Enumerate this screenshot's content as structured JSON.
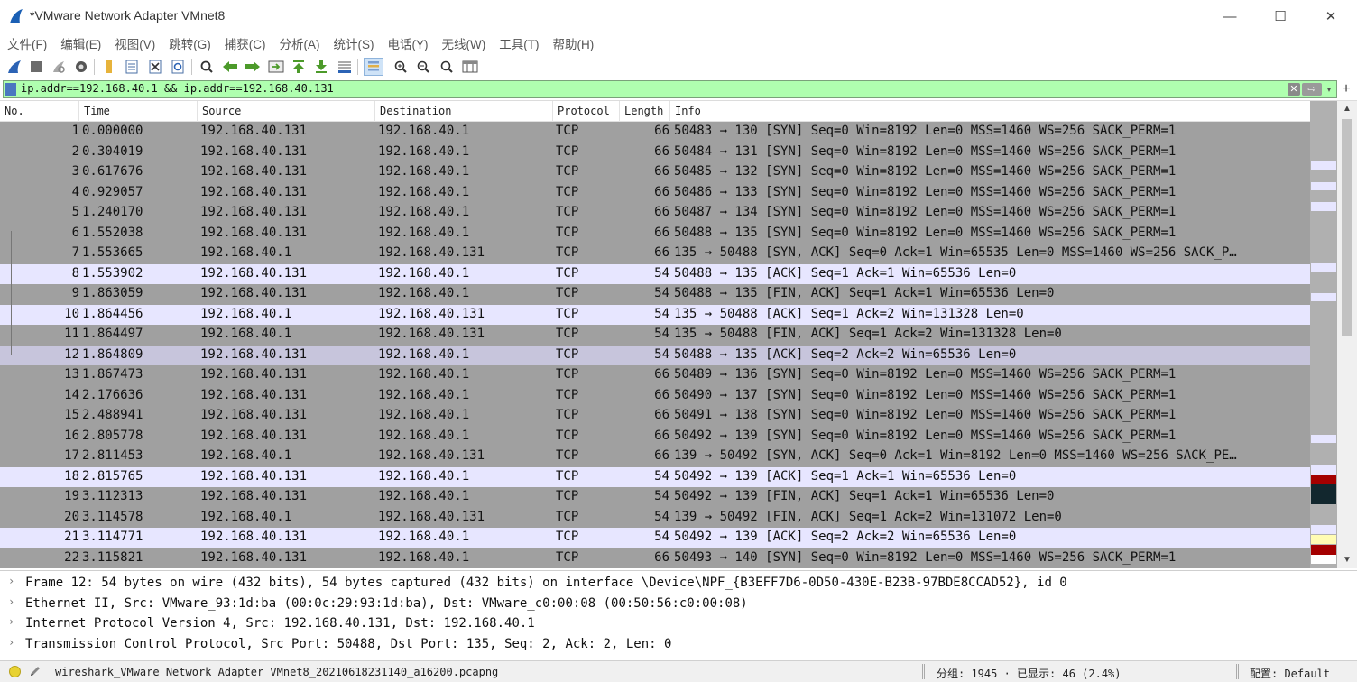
{
  "window": {
    "title": "*VMware Network Adapter VMnet8",
    "minimize_glyph": "—",
    "maximize_glyph": "☐",
    "close_glyph": "✕"
  },
  "menu": [
    "文件(F)",
    "编辑(E)",
    "视图(V)",
    "跳转(G)",
    "捕获(C)",
    "分析(A)",
    "统计(S)",
    "电话(Y)",
    "无线(W)",
    "工具(T)",
    "帮助(H)"
  ],
  "toolbar": {
    "icons": [
      "shark-fin-start-icon",
      "stop-capture-icon",
      "restart-capture-icon",
      "capture-options-icon",
      "open-file-icon",
      "save-file-icon",
      "close-file-icon",
      "reload-file-icon",
      "find-packet-icon",
      "go-back-icon",
      "go-forward-icon",
      "go-to-packet-icon",
      "go-first-icon",
      "go-last-icon",
      "autoscroll-icon",
      "colorize-icon",
      "zoom-in-icon",
      "zoom-out-icon",
      "normal-size-icon",
      "resize-columns-icon"
    ]
  },
  "filter": {
    "value": "ip.addr==192.168.40.1 && ip.addr==192.168.40.131",
    "clear_glyph": "✕",
    "apply_glyph": "⇨",
    "dropdown_glyph": "▾",
    "add_glyph": "+"
  },
  "columns": {
    "no": "No.",
    "time": "Time",
    "source": "Source",
    "destination": "Destination",
    "protocol": "Protocol",
    "length": "Length",
    "info": "Info"
  },
  "packets": [
    {
      "no": "1",
      "time": "0.000000",
      "src": "192.168.40.131",
      "dst": "192.168.40.1",
      "proto": "TCP",
      "len": "66",
      "info": "50483 → 130 [SYN] Seq=0 Win=8192 Len=0 MSS=1460 WS=256 SACK_PERM=1",
      "style": "sel"
    },
    {
      "no": "2",
      "time": "0.304019",
      "src": "192.168.40.131",
      "dst": "192.168.40.1",
      "proto": "TCP",
      "len": "66",
      "info": "50484 → 131 [SYN] Seq=0 Win=8192 Len=0 MSS=1460 WS=256 SACK_PERM=1",
      "style": "sel"
    },
    {
      "no": "3",
      "time": "0.617676",
      "src": "192.168.40.131",
      "dst": "192.168.40.1",
      "proto": "TCP",
      "len": "66",
      "info": "50485 → 132 [SYN] Seq=0 Win=8192 Len=0 MSS=1460 WS=256 SACK_PERM=1",
      "style": "sel"
    },
    {
      "no": "4",
      "time": "0.929057",
      "src": "192.168.40.131",
      "dst": "192.168.40.1",
      "proto": "TCP",
      "len": "66",
      "info": "50486 → 133 [SYN] Seq=0 Win=8192 Len=0 MSS=1460 WS=256 SACK_PERM=1",
      "style": "sel"
    },
    {
      "no": "5",
      "time": "1.240170",
      "src": "192.168.40.131",
      "dst": "192.168.40.1",
      "proto": "TCP",
      "len": "66",
      "info": "50487 → 134 [SYN] Seq=0 Win=8192 Len=0 MSS=1460 WS=256 SACK_PERM=1",
      "style": "sel"
    },
    {
      "no": "6",
      "time": "1.552038",
      "src": "192.168.40.131",
      "dst": "192.168.40.1",
      "proto": "TCP",
      "len": "66",
      "info": "50488 → 135 [SYN] Seq=0 Win=8192 Len=0 MSS=1460 WS=256 SACK_PERM=1",
      "style": "sel"
    },
    {
      "no": "7",
      "time": "1.553665",
      "src": "192.168.40.1",
      "dst": "192.168.40.131",
      "proto": "TCP",
      "len": "66",
      "info": "135 → 50488 [SYN, ACK] Seq=0 Ack=1 Win=65535 Len=0 MSS=1460 WS=256 SACK_P…",
      "style": "sel"
    },
    {
      "no": "8",
      "time": "1.553902",
      "src": "192.168.40.131",
      "dst": "192.168.40.1",
      "proto": "TCP",
      "len": "54",
      "info": "50488 → 135 [ACK] Seq=1 Ack=1 Win=65536 Len=0",
      "style": "lav"
    },
    {
      "no": "9",
      "time": "1.863059",
      "src": "192.168.40.131",
      "dst": "192.168.40.1",
      "proto": "TCP",
      "len": "54",
      "info": "50488 → 135 [FIN, ACK] Seq=1 Ack=1 Win=65536 Len=0",
      "style": "sel"
    },
    {
      "no": "10",
      "time": "1.864456",
      "src": "192.168.40.1",
      "dst": "192.168.40.131",
      "proto": "TCP",
      "len": "54",
      "info": "135 → 50488 [ACK] Seq=1 Ack=2 Win=131328 Len=0",
      "style": "lav"
    },
    {
      "no": "11",
      "time": "1.864497",
      "src": "192.168.40.1",
      "dst": "192.168.40.131",
      "proto": "TCP",
      "len": "54",
      "info": "135 → 50488 [FIN, ACK] Seq=1 Ack=2 Win=131328 Len=0",
      "style": "sel"
    },
    {
      "no": "12",
      "time": "1.864809",
      "src": "192.168.40.131",
      "dst": "192.168.40.1",
      "proto": "TCP",
      "len": "54",
      "info": "50488 → 135 [ACK] Seq=2 Ack=2 Win=65536 Len=0",
      "style": "cur"
    },
    {
      "no": "13",
      "time": "1.867473",
      "src": "192.168.40.131",
      "dst": "192.168.40.1",
      "proto": "TCP",
      "len": "66",
      "info": "50489 → 136 [SYN] Seq=0 Win=8192 Len=0 MSS=1460 WS=256 SACK_PERM=1",
      "style": "sel"
    },
    {
      "no": "14",
      "time": "2.176636",
      "src": "192.168.40.131",
      "dst": "192.168.40.1",
      "proto": "TCP",
      "len": "66",
      "info": "50490 → 137 [SYN] Seq=0 Win=8192 Len=0 MSS=1460 WS=256 SACK_PERM=1",
      "style": "sel"
    },
    {
      "no": "15",
      "time": "2.488941",
      "src": "192.168.40.131",
      "dst": "192.168.40.1",
      "proto": "TCP",
      "len": "66",
      "info": "50491 → 138 [SYN] Seq=0 Win=8192 Len=0 MSS=1460 WS=256 SACK_PERM=1",
      "style": "sel"
    },
    {
      "no": "16",
      "time": "2.805778",
      "src": "192.168.40.131",
      "dst": "192.168.40.1",
      "proto": "TCP",
      "len": "66",
      "info": "50492 → 139 [SYN] Seq=0 Win=8192 Len=0 MSS=1460 WS=256 SACK_PERM=1",
      "style": "sel"
    },
    {
      "no": "17",
      "time": "2.811453",
      "src": "192.168.40.1",
      "dst": "192.168.40.131",
      "proto": "TCP",
      "len": "66",
      "info": "139 → 50492 [SYN, ACK] Seq=0 Ack=1 Win=8192 Len=0 MSS=1460 WS=256 SACK_PE…",
      "style": "sel"
    },
    {
      "no": "18",
      "time": "2.815765",
      "src": "192.168.40.131",
      "dst": "192.168.40.1",
      "proto": "TCP",
      "len": "54",
      "info": "50492 → 139 [ACK] Seq=1 Ack=1 Win=65536 Len=0",
      "style": "lav"
    },
    {
      "no": "19",
      "time": "3.112313",
      "src": "192.168.40.131",
      "dst": "192.168.40.1",
      "proto": "TCP",
      "len": "54",
      "info": "50492 → 139 [FIN, ACK] Seq=1 Ack=1 Win=65536 Len=0",
      "style": "sel"
    },
    {
      "no": "20",
      "time": "3.114578",
      "src": "192.168.40.1",
      "dst": "192.168.40.131",
      "proto": "TCP",
      "len": "54",
      "info": "139 → 50492 [FIN, ACK] Seq=1 Ack=2 Win=131072 Len=0",
      "style": "sel"
    },
    {
      "no": "21",
      "time": "3.114771",
      "src": "192.168.40.131",
      "dst": "192.168.40.1",
      "proto": "TCP",
      "len": "54",
      "info": "50492 → 139 [ACK] Seq=2 Ack=2 Win=65536 Len=0",
      "style": "lav"
    },
    {
      "no": "22",
      "time": "3.115821",
      "src": "192.168.40.131",
      "dst": "192.168.40.1",
      "proto": "TCP",
      "len": "66",
      "info": "50493 → 140 [SYN] Seq=0 Win=8192 Len=0 MSS=1460 WS=256 SACK_PERM=1",
      "style": "sel"
    }
  ],
  "details": [
    "Frame 12: 54 bytes on wire (432 bits), 54 bytes captured (432 bits) on interface \\Device\\NPF_{B3EFF7D6-0D50-430E-B23B-97BDE8CCAD52}, id 0",
    "Ethernet II, Src: VMware_93:1d:ba (00:0c:29:93:1d:ba), Dst: VMware_c0:00:08 (00:50:56:c0:00:08)",
    "Internet Protocol Version 4, Src: 192.168.40.131, Dst: 192.168.40.1",
    "Transmission Control Protocol, Src Port: 50488, Dst Port: 135, Seq: 2, Ack: 2, Len: 0"
  ],
  "details_chevron": "›",
  "status": {
    "file": "wireshark_VMware Network Adapter VMnet8_20210618231140_a16200.pcapng",
    "packets": "分组: 1945 · 已显示: 46 (2.4%)",
    "profile": "配置: Default"
  },
  "colors": {
    "filter_valid": "#afffaf",
    "row_selected_gray": "#a0a0a0",
    "row_lavender": "#e7e6ff",
    "row_current": "#c7c5dc",
    "minimap_red": "#a40000",
    "minimap_dark": "#12272e",
    "minimap_yellow": "#fffcb3"
  }
}
